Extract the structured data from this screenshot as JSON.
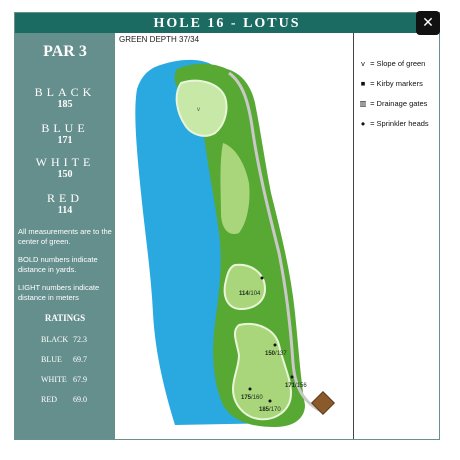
{
  "title": "HOLE 16 - LOTUS",
  "close_label": "✕",
  "par": "PAR 3",
  "tees": [
    {
      "name": "BLACK",
      "yards": "185"
    },
    {
      "name": "BLUE",
      "yards": "171"
    },
    {
      "name": "WHITE",
      "yards": "150"
    },
    {
      "name": "RED",
      "yards": "114"
    }
  ],
  "notes": [
    "All measurements are to the center of green.",
    "BOLD numbers indicate distance in yards.",
    "LIGHT numbers indicate distance in meters"
  ],
  "ratings_heading": "RATINGS",
  "ratings": [
    {
      "name": "BLACK",
      "value": "72.3"
    },
    {
      "name": "BLUE",
      "value": "69.7"
    },
    {
      "name": "WHITE",
      "value": "67.9"
    },
    {
      "name": "RED",
      "value": "69.0"
    }
  ],
  "green_depth": "GREEN DEPTH 37/34",
  "green_slope_mark": "v",
  "distance_markers": [
    {
      "yards": "114",
      "meters": "104"
    },
    {
      "yards": "150",
      "meters": "137"
    },
    {
      "yards": "171",
      "meters": "156"
    },
    {
      "yards": "175",
      "meters": "160"
    },
    {
      "yards": "185",
      "meters": "170"
    }
  ],
  "legend": [
    {
      "symbol": "v",
      "label": "= Slope of green"
    },
    {
      "symbol": "■",
      "label": "= Kirby markers"
    },
    {
      "symbol": "▥",
      "label": "= Drainage gates"
    },
    {
      "symbol": "●",
      "label": "= Sprinkler heads"
    }
  ],
  "colors": {
    "title_bar": "#1c6b62",
    "left_panel": "#658f8d",
    "water": "#29a9df",
    "rough": "#58a834",
    "fairway": "#a9d67a",
    "green": "#c7e8a6",
    "path": "#c9c9c9"
  }
}
